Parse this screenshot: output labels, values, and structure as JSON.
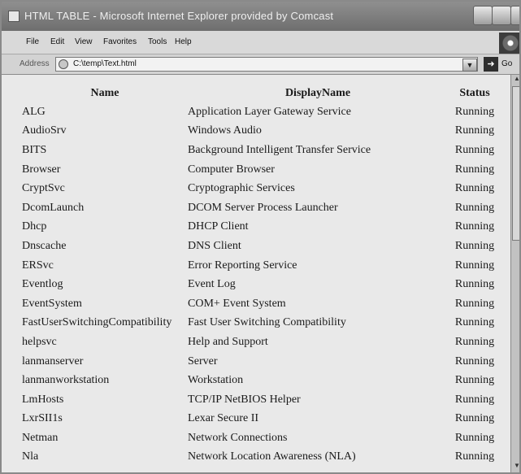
{
  "window": {
    "title": "HTML TABLE - Microsoft Internet Explorer provided by Comcast"
  },
  "menu": [
    "File",
    "Edit",
    "View",
    "Favorites",
    "Tools",
    "Help"
  ],
  "address": {
    "label": "Address",
    "value": "C:\\temp\\Text.html",
    "go_label": "Go"
  },
  "table": {
    "headers": [
      "Name",
      "DisplayName",
      "Status"
    ],
    "rows": [
      {
        "name": "ALG",
        "display": "Application Layer Gateway Service",
        "status": "Running"
      },
      {
        "name": "AudioSrv",
        "display": "Windows Audio",
        "status": "Running"
      },
      {
        "name": "BITS",
        "display": "Background Intelligent Transfer Service",
        "status": "Running"
      },
      {
        "name": "Browser",
        "display": "Computer Browser",
        "status": "Running"
      },
      {
        "name": "CryptSvc",
        "display": "Cryptographic Services",
        "status": "Running"
      },
      {
        "name": "DcomLaunch",
        "display": "DCOM Server Process Launcher",
        "status": "Running"
      },
      {
        "name": "Dhcp",
        "display": "DHCP Client",
        "status": "Running"
      },
      {
        "name": "Dnscache",
        "display": "DNS Client",
        "status": "Running"
      },
      {
        "name": "ERSvc",
        "display": "Error Reporting Service",
        "status": "Running"
      },
      {
        "name": "Eventlog",
        "display": "Event Log",
        "status": "Running"
      },
      {
        "name": "EventSystem",
        "display": "COM+ Event System",
        "status": "Running"
      },
      {
        "name": "FastUserSwitchingCompatibility",
        "display": "Fast User Switching Compatibility",
        "status": "Running"
      },
      {
        "name": "helpsvc",
        "display": "Help and Support",
        "status": "Running"
      },
      {
        "name": "lanmanserver",
        "display": "Server",
        "status": "Running"
      },
      {
        "name": "lanmanworkstation",
        "display": "Workstation",
        "status": "Running"
      },
      {
        "name": "LmHosts",
        "display": "TCP/IP NetBIOS Helper",
        "status": "Running"
      },
      {
        "name": "LxrSII1s",
        "display": "Lexar Secure II",
        "status": "Running"
      },
      {
        "name": "Netman",
        "display": "Network Connections",
        "status": "Running"
      },
      {
        "name": "Nla",
        "display": "Network Location Awareness (NLA)",
        "status": "Running"
      }
    ]
  }
}
